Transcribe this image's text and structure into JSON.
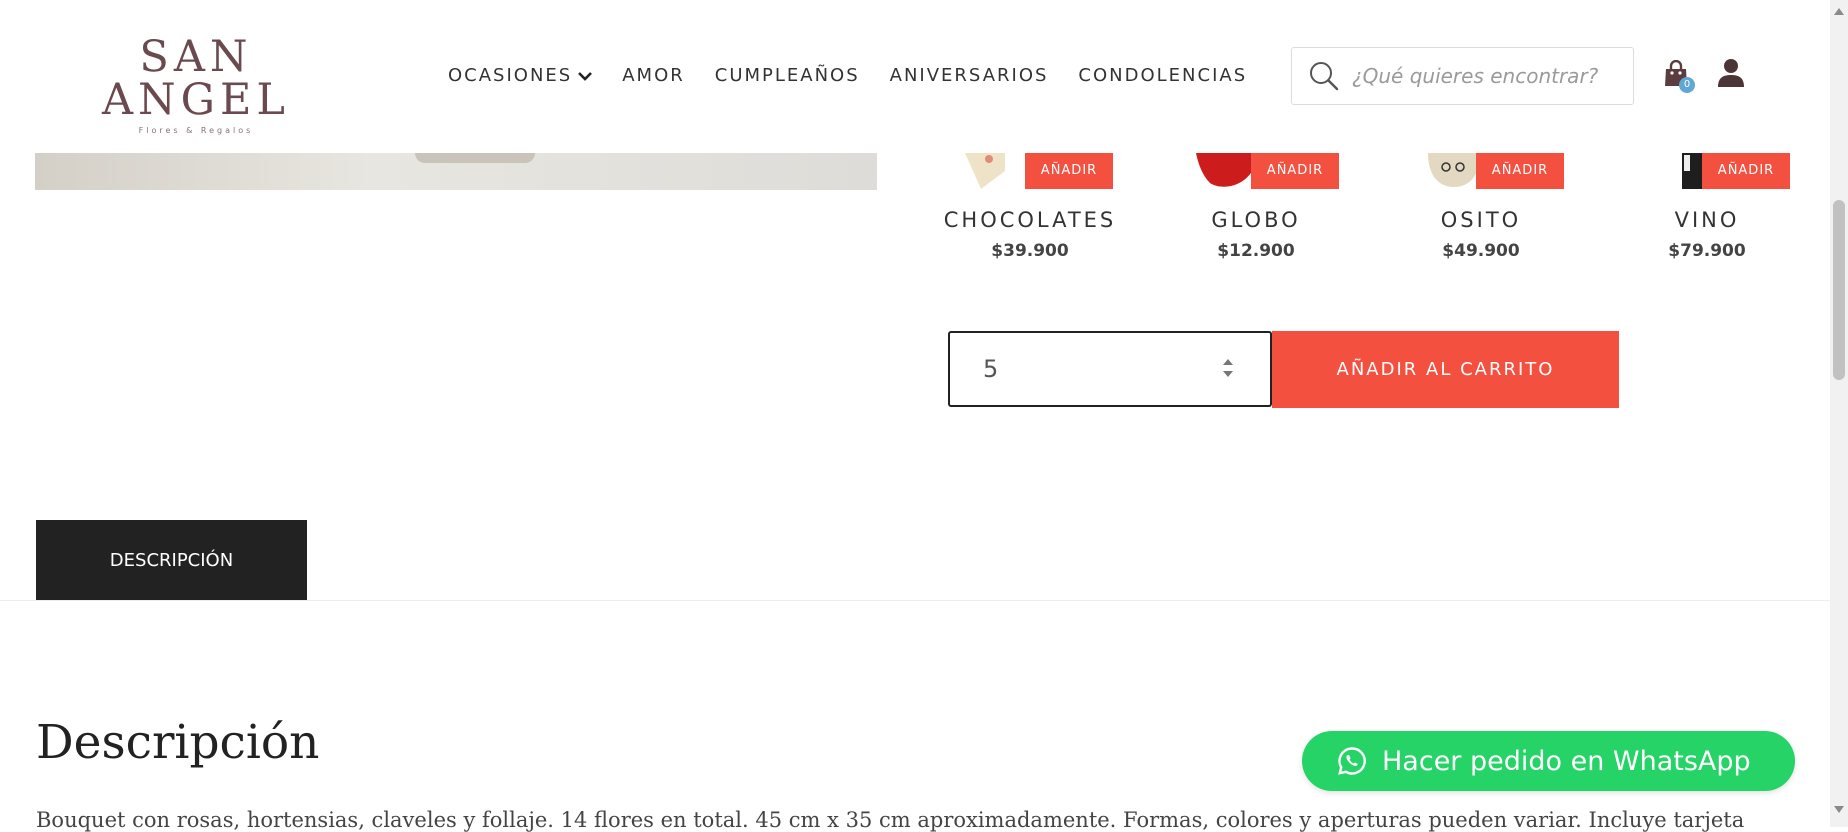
{
  "header": {
    "logo_title": "SAN ANGEL",
    "logo_subtitle": "Flores & Regalos",
    "nav": [
      {
        "label": "OCASIONES",
        "has_dropdown": true
      },
      {
        "label": "AMOR"
      },
      {
        "label": "CUMPLEAÑOS"
      },
      {
        "label": "ANIVERSARIOS"
      },
      {
        "label": "CONDOLENCIAS"
      }
    ],
    "search_placeholder": "¿Qué quieres encontrar?",
    "cart_count": "0",
    "icons": {
      "search": "search-icon",
      "cart": "shopping-bag-icon",
      "user": "user-icon",
      "dropdown": "chevron-down-icon"
    }
  },
  "addons": [
    {
      "name": "CHOCOLATES",
      "price": "$39.900",
      "button": "AÑADIR"
    },
    {
      "name": "GLOBO",
      "price": "$12.900",
      "button": "AÑADIR"
    },
    {
      "name": "OSITO",
      "price": "$49.900",
      "button": "AÑADIR"
    },
    {
      "name": "VINO",
      "price": "$79.900",
      "button": "AÑADIR"
    }
  ],
  "purchase": {
    "quantity": "5",
    "add_to_cart_label": "AÑADIR AL CARRITO"
  },
  "tabs": {
    "description_tab": "DESCRIPCIÓN"
  },
  "description": {
    "heading": "Descripción",
    "text": "Bouquet con rosas, hortensias, claveles y follaje. 14 flores en total. 45  cm x 35 cm aproximadamente. Formas, colores y aperturas pueden variar. Incluye tarjeta"
  },
  "whatsapp": {
    "label": "Hacer pedido en WhatsApp",
    "color": "#25d366"
  },
  "colors": {
    "accent": "#f35040",
    "dark": "#222222",
    "brand": "#6b4a4f"
  }
}
